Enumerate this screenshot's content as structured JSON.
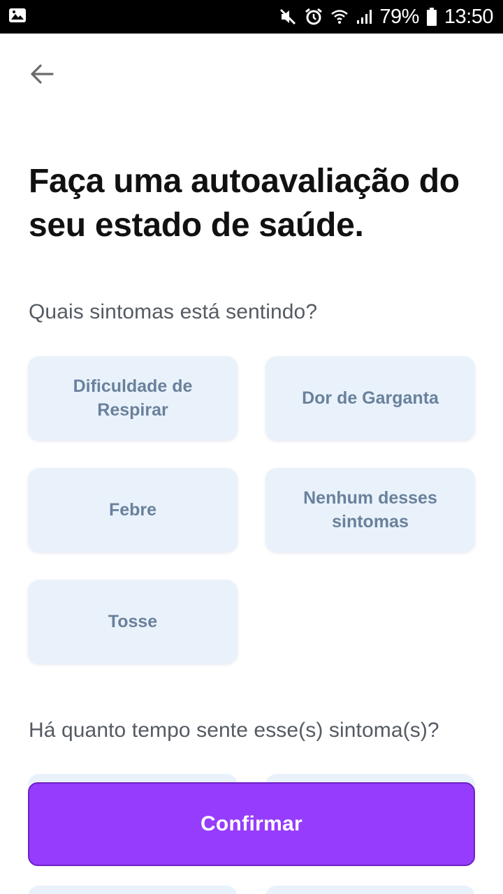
{
  "status_bar": {
    "battery": "79%",
    "time": "13:50",
    "icons": [
      "image-icon",
      "mute-icon",
      "alarm-icon",
      "wifi-icon",
      "signal-icon",
      "battery-icon"
    ]
  },
  "header": {
    "back_icon": "arrow-left-icon"
  },
  "title": "Faça uma autoavaliação do seu estado de saúde.",
  "questions": {
    "symptoms": "Quais sintomas está sentindo?",
    "duration": "Há quanto tempo sente esse(s) sintoma(s)?"
  },
  "symptom_options": [
    "Dificuldade de Respirar",
    "Dor de Garganta",
    "Febre",
    "Nenhum desses sintomas",
    "Tosse"
  ],
  "confirm_label": "Confirmar",
  "colors": {
    "chip_bg": "#e9f2fb",
    "chip_text": "#6a819c",
    "primary": "#963cfd"
  }
}
